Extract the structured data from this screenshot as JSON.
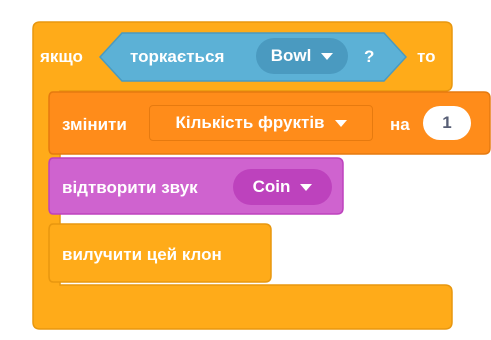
{
  "if_block": {
    "if_label": "якщо",
    "then_label": "то",
    "condition": {
      "label": "торкається",
      "target": "Bowl",
      "question": "?"
    }
  },
  "change_block": {
    "label": "змінити",
    "variable": "Кількість фруктів",
    "by_label": "на",
    "value": "1"
  },
  "sound_block": {
    "label": "відтворити звук",
    "sound": "Coin"
  },
  "delete_block": {
    "label": "вилучити цей клон"
  },
  "colors": {
    "control": "#ffab19",
    "variables": "#ff8c1a",
    "sound": "#cf63cf",
    "sensing": "#5cb1d6"
  }
}
